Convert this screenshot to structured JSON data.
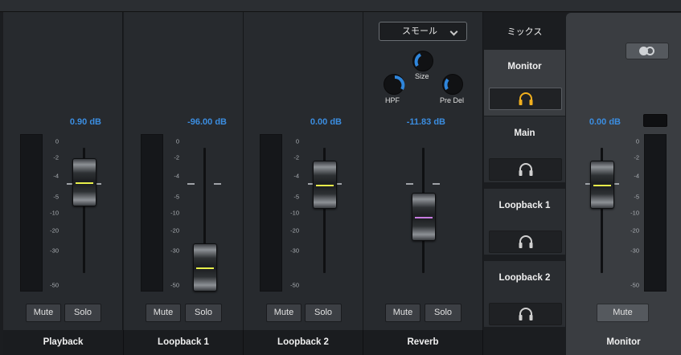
{
  "scale_labels": [
    "0",
    "-2",
    "-4",
    "-5",
    "-10",
    "-20",
    "-30",
    "-50"
  ],
  "strips": [
    {
      "name": "Playback",
      "db": "0.90 dB",
      "mute": "Mute",
      "solo": "Solo",
      "level_db": 0.9
    },
    {
      "name": "Loopback 1",
      "db": "-96.00 dB",
      "mute": "Mute",
      "solo": "Solo",
      "level_db": -96.0
    },
    {
      "name": "Loopback 2",
      "db": "0.00 dB",
      "mute": "Mute",
      "solo": "Solo",
      "level_db": 0.0
    }
  ],
  "reverb": {
    "preset": "スモール",
    "knobs": {
      "size": "Size",
      "hpf": "HPF",
      "predelay": "Pre Del"
    },
    "db": "-11.83 dB",
    "mute": "Mute",
    "solo": "Solo",
    "name": "Reverb",
    "level_db": -11.83
  },
  "mix": {
    "header": "ミックス",
    "items": [
      {
        "label": "Monitor",
        "active": true
      },
      {
        "label": "Main",
        "active": false
      },
      {
        "label": "Loopback 1",
        "active": false
      },
      {
        "label": "Loopback 2",
        "active": false
      }
    ]
  },
  "monitor": {
    "name": "Monitor",
    "db": "0.00 dB",
    "mute": "Mute",
    "level_db": 0.0
  },
  "colors": {
    "db_text": "#3b8de0",
    "fader_line": "#e8f04a",
    "reverb_line": "#c77be0",
    "active_headphone": "#f2b01e"
  }
}
